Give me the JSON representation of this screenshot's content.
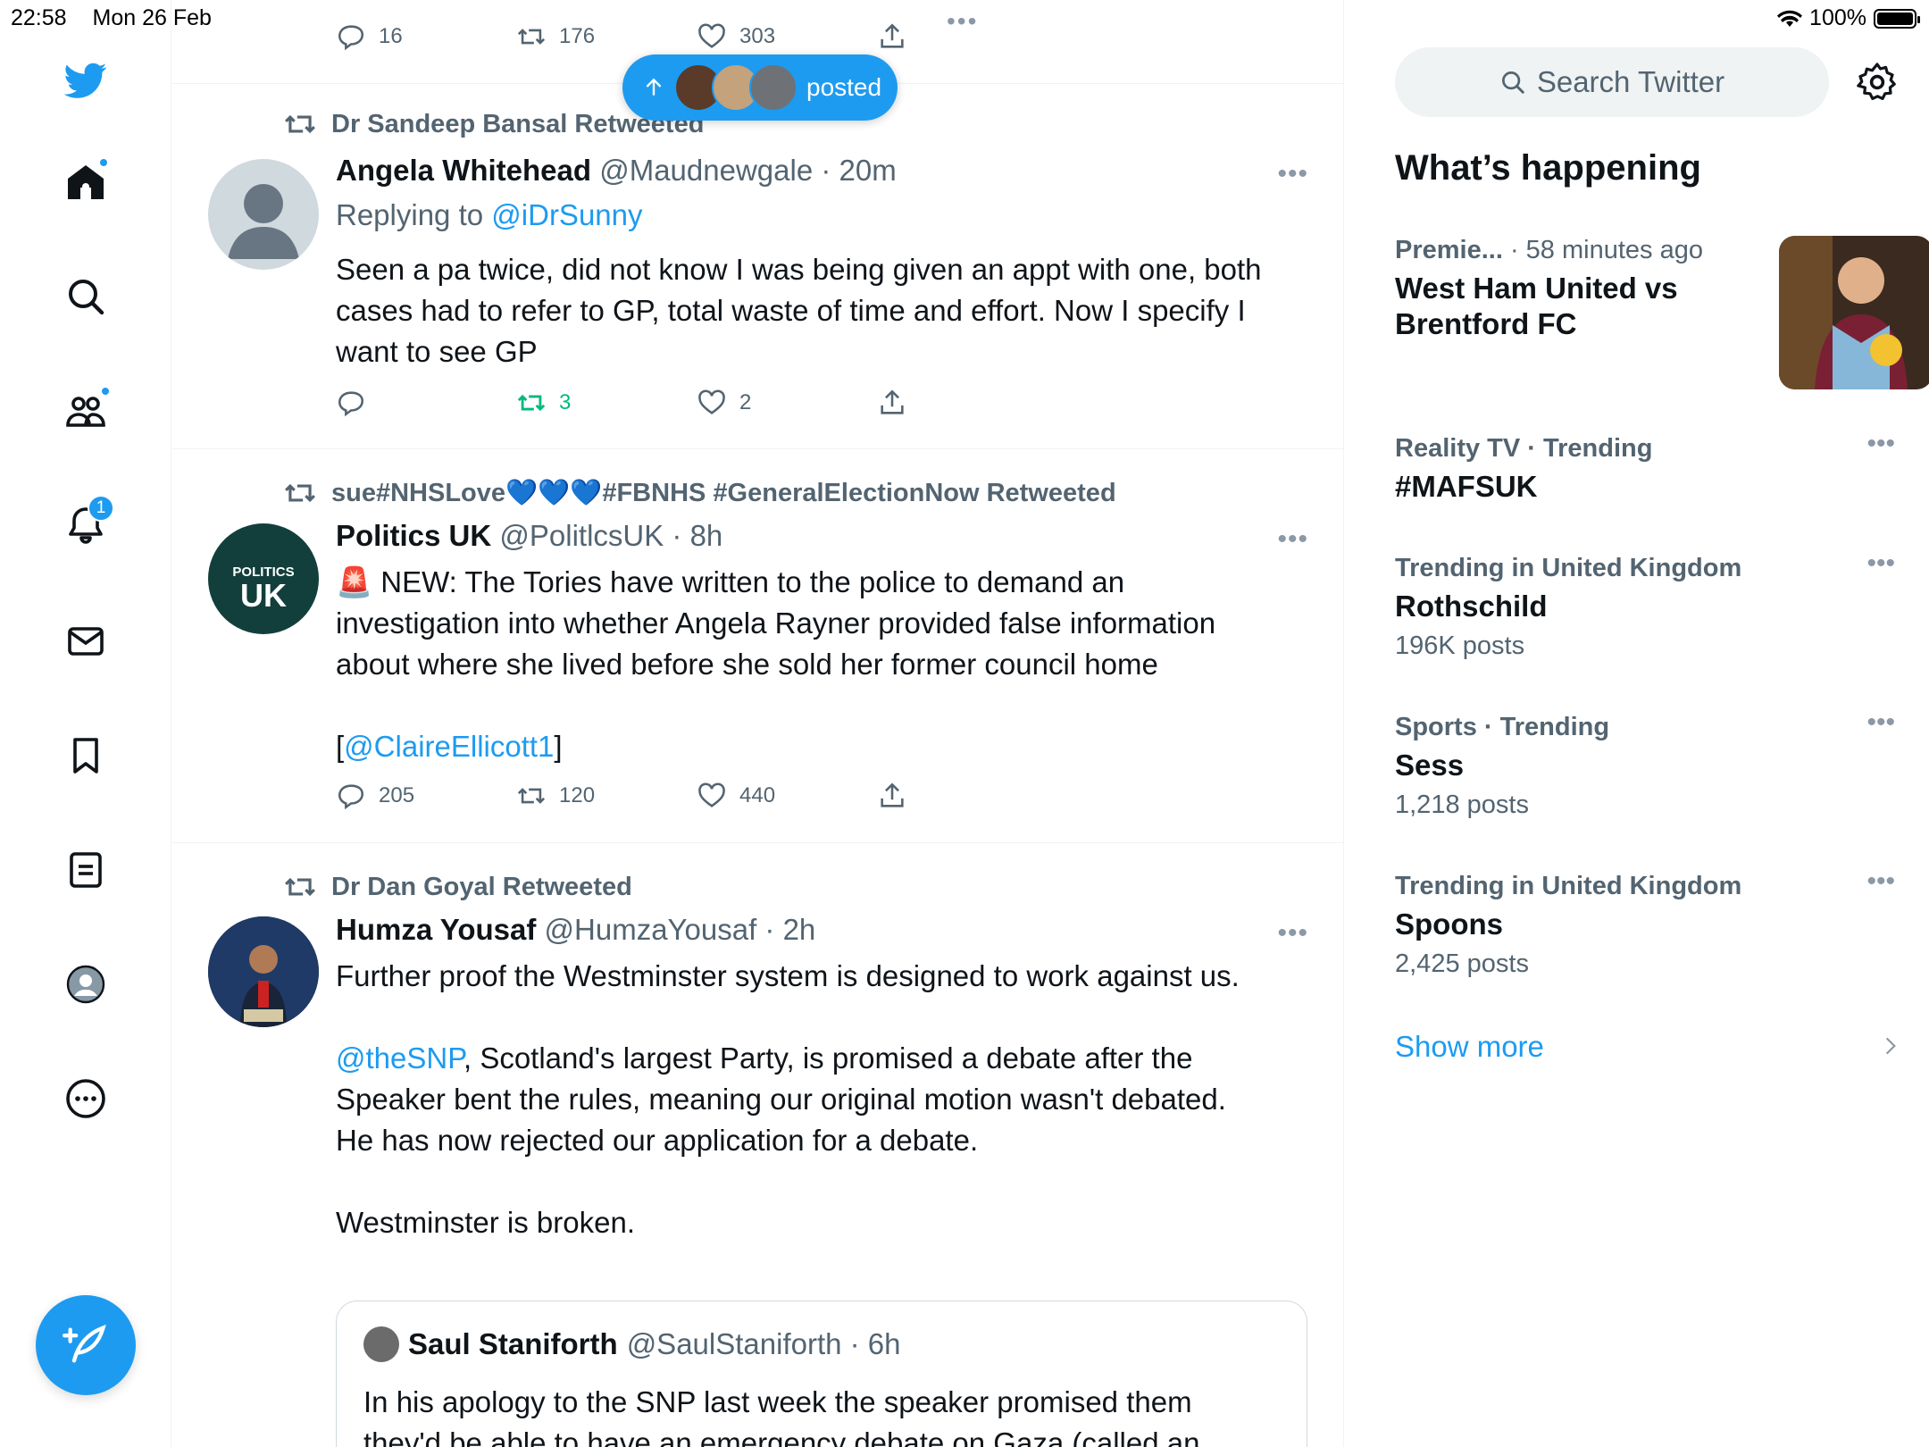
{
  "status": {
    "time": "22:58",
    "date": "Mon 26 Feb",
    "battery": "100%",
    "dots": "•••"
  },
  "nav": {
    "items": [
      "twitter-logo",
      "home",
      "explore",
      "communities",
      "notifications",
      "messages",
      "bookmarks",
      "lists",
      "profile",
      "more"
    ],
    "notification_count": "1"
  },
  "colors": {
    "accent": "#1d9bf0",
    "text": "#0f1419",
    "muted": "#536471",
    "retweet_green": "#00ba7c"
  },
  "pill": {
    "label": "posted"
  },
  "top_partial": {
    "replies": "16",
    "retweets": "176",
    "likes": "303"
  },
  "tweets": [
    {
      "retweeted_by": "Dr Sandeep Bansal Retweeted",
      "name": "Angela Whitehead",
      "meta": "@Maudnewgale · 20m",
      "replying_label": "Replying to",
      "replying_handle": "@iDrSunny",
      "body": "Seen a pa twice, did not know I was being given an appt with one, both cases had to refer to GP, total waste of time and effort. Now I specify I want to see GP",
      "replies": "",
      "retweets": "3",
      "likes": "2"
    },
    {
      "retweeted_by": "sue#NHSLove💙💙💙#FBNHS #GeneralElectionNow Retweeted",
      "name": "Politics UK",
      "meta": "@PolitlcsUK · 8h",
      "body": "🚨 NEW: The Tories have written to the police to demand an investigation into whether Angela Rayner provided false information about where she lived before she sold her former council home",
      "body_open": "[",
      "body_link": "@ClaireEllicott1",
      "body_close": "]",
      "avatar_text_top": "POLITICS",
      "avatar_text_bottom": "UK",
      "replies": "205",
      "retweets": "120",
      "likes": "440"
    },
    {
      "retweeted_by": "Dr Dan Goyal Retweeted",
      "name": "Humza Yousaf",
      "meta": "@HumzaYousaf · 2h",
      "line1": "Further proof the Westminster system is designed to work against us.",
      "link": "@theSNP",
      "line2": ", Scotland's largest Party, is promised a debate after the Speaker bent the rules, meaning our original motion wasn't debated.",
      "line3": "He has now rejected our application for a debate.",
      "line4": "Westminster is broken.",
      "quote": {
        "name": "Saul Staniforth",
        "meta": "@SaulStaniforth · 6h",
        "body": "In his apology to the SNP last week the speaker promised them they'd be able to have an emergency debate on Gaza (called an"
      }
    }
  ],
  "right": {
    "search_placeholder": "Search Twitter",
    "title": "What’s happening",
    "trends": [
      {
        "category": "Premie...",
        "context": "· 58 minutes ago",
        "title": "West Ham United vs Brentford FC",
        "count": ""
      },
      {
        "category": "Reality TV · Trending",
        "context": "",
        "title": "#MAFSUK",
        "count": ""
      },
      {
        "category": "Trending in United Kingdom",
        "context": "",
        "title": "Rothschild",
        "count": "196K posts"
      },
      {
        "category": "Sports · Trending",
        "context": "",
        "title": "Sess",
        "count": "1,218 posts"
      },
      {
        "category": "Trending in United Kingdom",
        "context": "",
        "title": "Spoons",
        "count": "2,425 posts"
      }
    ],
    "show_more": "Show more"
  }
}
